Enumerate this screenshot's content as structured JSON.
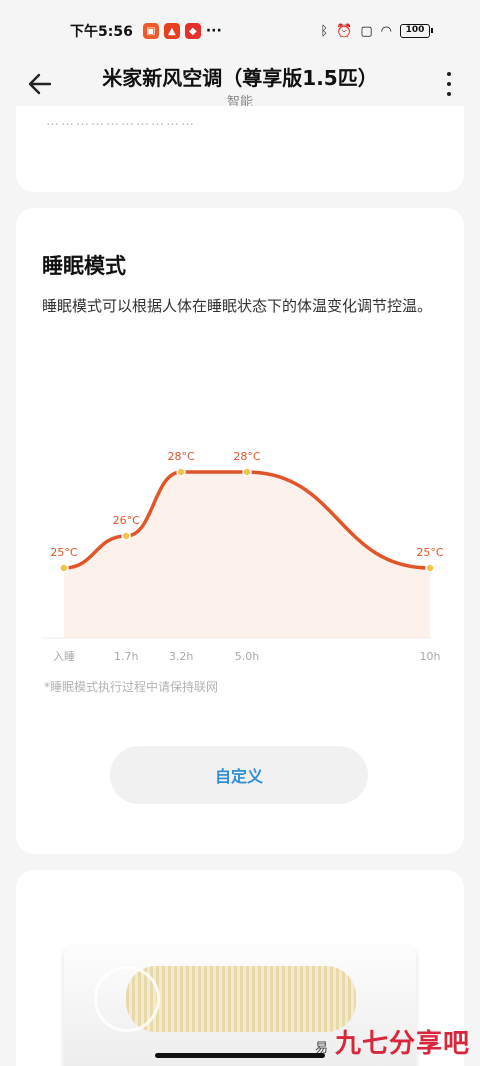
{
  "status_bar": {
    "time": "下午5:56",
    "battery": "100"
  },
  "header": {
    "title": "米家新风空调（尊享版1.5匹）",
    "subtitle": "智能"
  },
  "top_card": {
    "faded_text": "…………………………"
  },
  "sleep_card": {
    "title": "睡眠模式",
    "description": "睡眠模式可以根据人体在睡眠状态下的体温变化调节控温。",
    "note": "*睡眠模式执行过程中请保持联网",
    "custom_button": "自定义"
  },
  "chart_data": {
    "type": "line",
    "x": [
      "入睡",
      "1.7h",
      "3.2h",
      "5.0h",
      "10h"
    ],
    "x_hours": [
      0,
      1.7,
      3.2,
      5.0,
      10
    ],
    "values": [
      25,
      26,
      28,
      28,
      25
    ],
    "point_labels": [
      "25°C",
      "26°C",
      "28°C",
      "28°C",
      "25°C"
    ],
    "series_color": "#e2552a",
    "fill_color": "#fbe7df"
  },
  "colors": {
    "accent": "#2f8fd8",
    "curve": "#e2552a"
  },
  "watermark": {
    "small": "易",
    "brand": "九七分享吧"
  }
}
